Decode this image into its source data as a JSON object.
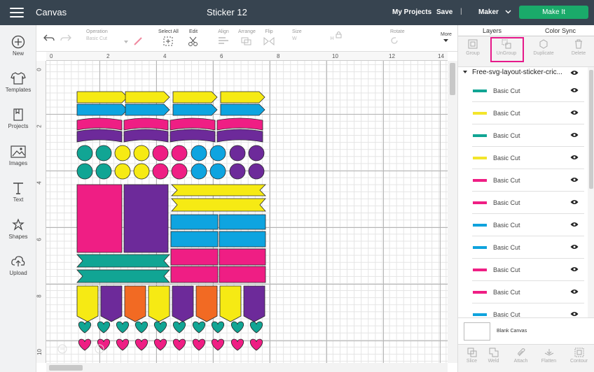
{
  "topbar": {
    "app_title": "Canvas",
    "project_name": "Sticker 12",
    "my_projects": "My Projects",
    "save": "Save",
    "separator": "|",
    "machine": "Maker",
    "make_it": "Make It"
  },
  "nav": [
    {
      "label": "New",
      "icon": "plus-icon"
    },
    {
      "label": "Templates",
      "icon": "shirt-icon"
    },
    {
      "label": "Projects",
      "icon": "projects-icon"
    },
    {
      "label": "Images",
      "icon": "image-icon"
    },
    {
      "label": "Text",
      "icon": "text-icon"
    },
    {
      "label": "Shapes",
      "icon": "shapes-icon"
    },
    {
      "label": "Upload",
      "icon": "upload-icon"
    }
  ],
  "toolbar": {
    "operation_label": "Operation",
    "operation_value": "Basic Cut",
    "select_all": "Select All",
    "edit": "Edit",
    "align": "Align",
    "arrange": "Arrange",
    "flip": "Flip",
    "size": "Size",
    "size_w": "W",
    "size_h": "H",
    "rotate": "Rotate",
    "more": "More"
  },
  "ruler": {
    "top": [
      "0",
      "2",
      "4",
      "6",
      "8",
      "10",
      "12",
      "14"
    ],
    "left": [
      "0",
      "2",
      "4",
      "6",
      "8",
      "10"
    ]
  },
  "panel": {
    "tab_layers": "Layers",
    "tab_color_sync": "Color Sync",
    "actions": [
      "Group",
      "UnGroup",
      "Duplicate",
      "Delete"
    ],
    "group_name": "Free-svg-layout-sticker-cric...",
    "layers": [
      {
        "name": "Basic Cut",
        "color": "#11a594"
      },
      {
        "name": "Basic Cut",
        "color": "#f3e52b"
      },
      {
        "name": "Basic Cut",
        "color": "#11a594"
      },
      {
        "name": "Basic Cut",
        "color": "#f3e52b"
      },
      {
        "name": "Basic Cut",
        "color": "#ef1e84"
      },
      {
        "name": "Basic Cut",
        "color": "#ef1e84"
      },
      {
        "name": "Basic Cut",
        "color": "#0fa3dd"
      },
      {
        "name": "Basic Cut",
        "color": "#0fa3dd"
      },
      {
        "name": "Basic Cut",
        "color": "#ef1e84"
      },
      {
        "name": "Basic Cut",
        "color": "#ef1e84"
      },
      {
        "name": "Basic Cut",
        "color": "#0fa3dd"
      }
    ],
    "blank_canvas": "Blank Canvas",
    "bottom_actions": [
      "Slice",
      "Weld",
      "Attach",
      "Flatten",
      "Contour"
    ]
  },
  "colors": {
    "yellow": "#f6ea14",
    "blue": "#0ea4e0",
    "purple": "#6d2a9a",
    "teal": "#11a594",
    "pink": "#ef1e84",
    "orange": "#f26a23",
    "highlight": "#e6198a",
    "make_it": "#1aaa6a"
  }
}
